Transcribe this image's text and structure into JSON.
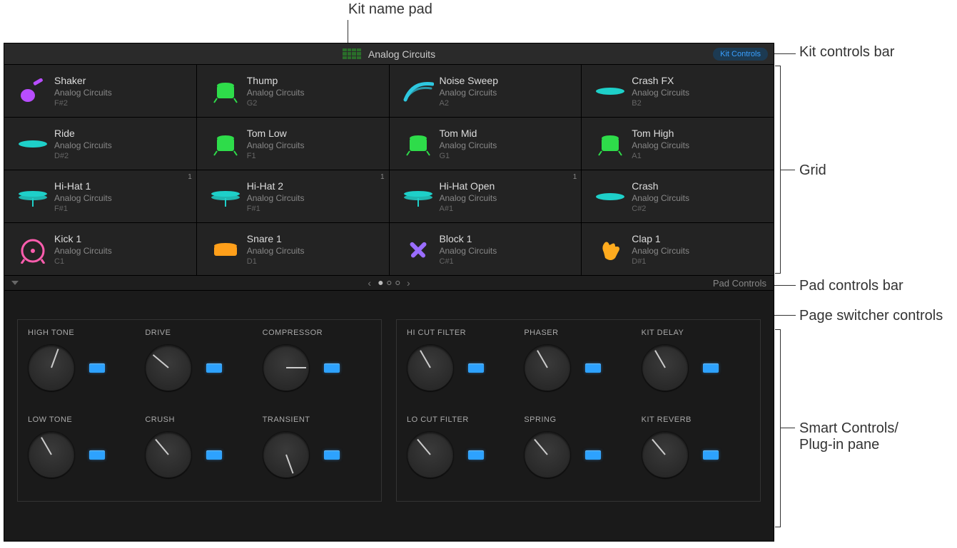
{
  "annotations": {
    "kit_name_pad": "Kit name pad",
    "kit_controls_bar": "Kit controls bar",
    "grid": "Grid",
    "pad_controls_bar": "Pad controls bar",
    "page_switcher_controls": "Page switcher controls",
    "smart_controls_pane": "Smart Controls/\nPlug-in pane"
  },
  "header": {
    "kit_name": "Analog Circuits",
    "kit_controls_button": "Kit Controls"
  },
  "pad_bar": {
    "label": "Pad Controls"
  },
  "pads": [
    {
      "name": "Shaker",
      "sub": "Analog Circuits",
      "note": "F#2",
      "icon": "shaker",
      "color": "#b84dff"
    },
    {
      "name": "Thump",
      "sub": "Analog Circuits",
      "note": "G2",
      "icon": "tom",
      "color": "#2edc4a"
    },
    {
      "name": "Noise Sweep",
      "sub": "Analog Circuits",
      "note": "A2",
      "icon": "sweep",
      "color": "#2ec8e0"
    },
    {
      "name": "Crash FX",
      "sub": "Analog Circuits",
      "note": "B2",
      "icon": "cymbal",
      "color": "#1ed0c9"
    },
    {
      "name": "Ride",
      "sub": "Analog Circuits",
      "note": "D#2",
      "icon": "cymbal",
      "color": "#1ed0c9"
    },
    {
      "name": "Tom Low",
      "sub": "Analog Circuits",
      "note": "F1",
      "icon": "tom",
      "color": "#2edc4a"
    },
    {
      "name": "Tom Mid",
      "sub": "Analog Circuits",
      "note": "G1",
      "icon": "tom",
      "color": "#2edc4a"
    },
    {
      "name": "Tom High",
      "sub": "Analog Circuits",
      "note": "A1",
      "icon": "tom",
      "color": "#2edc4a"
    },
    {
      "name": "Hi-Hat 1",
      "sub": "Analog Circuits",
      "note": "F#1",
      "icon": "hihat",
      "color": "#1ed0c9",
      "badge": "1"
    },
    {
      "name": "Hi-Hat 2",
      "sub": "Analog Circuits",
      "note": "F#1",
      "icon": "hihat",
      "color": "#1ed0c9",
      "badge": "1"
    },
    {
      "name": "Hi-Hat Open",
      "sub": "Analog Circuits",
      "note": "A#1",
      "icon": "hihat",
      "color": "#1ed0c9",
      "badge": "1"
    },
    {
      "name": "Crash",
      "sub": "Analog Circuits",
      "note": "C#2",
      "icon": "cymbal",
      "color": "#1ed0c9"
    },
    {
      "name": "Kick 1",
      "sub": "Analog Circuits",
      "note": "C1",
      "icon": "kick",
      "color": "#ff5dae"
    },
    {
      "name": "Snare 1",
      "sub": "Analog Circuits",
      "note": "D1",
      "icon": "snare",
      "color": "#ff9f1a"
    },
    {
      "name": "Block 1",
      "sub": "Analog Circuits",
      "note": "C#1",
      "icon": "sticks",
      "color": "#9a6dff"
    },
    {
      "name": "Clap 1",
      "sub": "Analog Circuits",
      "note": "D#1",
      "icon": "clap",
      "color": "#ffab1e"
    }
  ],
  "knobs": {
    "left": [
      {
        "label": "HIGH TONE",
        "angle": -160
      },
      {
        "label": "DRIVE",
        "angle": 130
      },
      {
        "label": "COMPRESSOR",
        "angle": -90
      },
      {
        "label": "LOW TONE",
        "angle": 150
      },
      {
        "label": "CRUSH",
        "angle": 140
      },
      {
        "label": "TRANSIENT",
        "angle": -20
      }
    ],
    "right": [
      {
        "label": "HI CUT FILTER",
        "angle": 150
      },
      {
        "label": "PHASER",
        "angle": 150
      },
      {
        "label": "KIT DELAY",
        "angle": 150
      },
      {
        "label": "LO CUT FILTER",
        "angle": 140
      },
      {
        "label": "SPRING",
        "angle": 140
      },
      {
        "label": "KIT REVERB",
        "angle": 140
      }
    ]
  }
}
